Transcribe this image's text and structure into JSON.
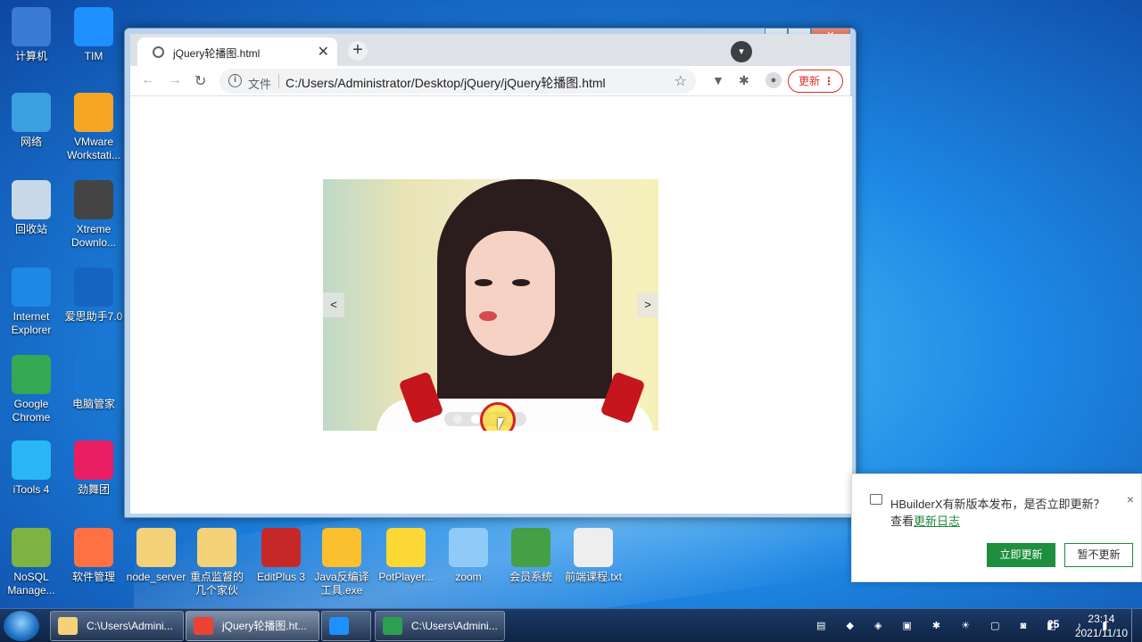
{
  "desktop": {
    "left_icons": [
      {
        "label": "计算机",
        "color": "#3a7bd5"
      },
      {
        "label": "TIM",
        "color": "#1e90ff"
      },
      {
        "label": "网络",
        "color": "#3aa0e0"
      },
      {
        "label": "VMware Workstati...",
        "color": "#f5a623"
      },
      {
        "label": "回收站",
        "color": "#c8d8e8"
      },
      {
        "label": "Xtreme Downlo...",
        "color": "#444444"
      },
      {
        "label": "Internet Explorer",
        "color": "#1e88e5"
      },
      {
        "label": "爱思助手7.0",
        "color": "#1565c0"
      },
      {
        "label": "Google Chrome",
        "color": "#34a853"
      },
      {
        "label": "电脑管家",
        "color": "#1976d2"
      },
      {
        "label": "iTools 4",
        "color": "#29b6f6"
      },
      {
        "label": "劲舞团",
        "color": "#e91e63"
      }
    ],
    "bottom_icons": [
      {
        "label": "NoSQL Manage...",
        "color": "#7cb342"
      },
      {
        "label": "软件管理",
        "color": "#ff7043"
      },
      {
        "label": "node_server",
        "color": "#f4d27a"
      },
      {
        "label": "重点监督的几个家伙",
        "color": "#f4d27a"
      },
      {
        "label": "EditPlus 3",
        "color": "#c62828"
      },
      {
        "label": "Java反编译工具.exe",
        "color": "#fbc02d"
      },
      {
        "label": "PotPlayer...",
        "color": "#fdd835"
      },
      {
        "label": "zoom",
        "color": "#90caf9"
      },
      {
        "label": "会员系统",
        "color": "#43a047"
      },
      {
        "label": "前端课程.txt",
        "color": "#eeeeee"
      }
    ]
  },
  "browser": {
    "tab_title": "jQuery轮播图.html",
    "close_glyph": "✕",
    "newtab_glyph": "+",
    "scheme_label": "文件",
    "url": "C:/Users/Administrator/Desktop/jQuery/jQuery轮播图.html",
    "update_label": "更新",
    "back_glyph": "←",
    "forward_glyph": "→",
    "reload_glyph": "↻",
    "star_glyph": "☆",
    "menu_glyph": "⋮"
  },
  "carousel": {
    "prev_label": "<",
    "next_label": ">",
    "dot_count": 4,
    "active_dot": 1
  },
  "notification": {
    "message": "HBuilderX有新版本发布，是否立即更新？",
    "prefix": "查看",
    "link_text": "更新日志",
    "primary_label": "立即更新",
    "secondary_label": "暂不更新",
    "close_glyph": "×"
  },
  "taskbar": {
    "tasks": [
      {
        "label": "C:\\Users\\Admini...",
        "color": "#f4d27a"
      },
      {
        "label": "jQuery轮播图.ht...",
        "color": "#ea4335"
      },
      {
        "label": "",
        "color": "#1e90ff"
      },
      {
        "label": "C:\\Users\\Admini...",
        "color": "#2e9e4f"
      }
    ],
    "tray_badge": "25",
    "time": "23:14",
    "date": "2021/11/10"
  }
}
